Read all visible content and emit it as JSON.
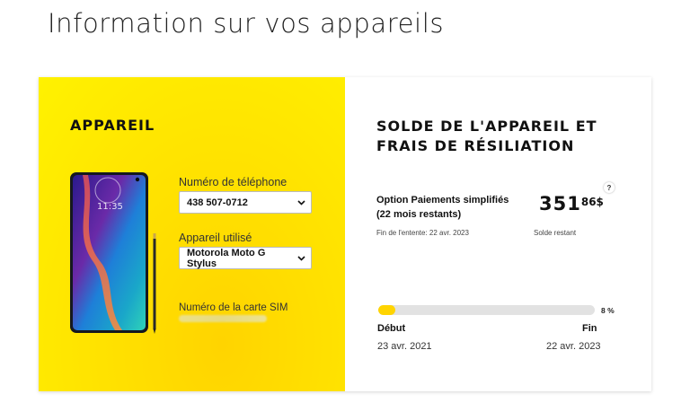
{
  "page": {
    "title": "Information sur vos appareils"
  },
  "device_panel": {
    "heading": "APPAREIL",
    "phone_number_label": "Numéro de téléphone",
    "phone_number_value": "438 507-0712",
    "device_label": "Appareil utilisé",
    "device_value": "Motorola Moto G Stylus",
    "sim_label": "Numéro de la carte SIM",
    "phone_clock": "11:35"
  },
  "balance_panel": {
    "heading": "SOLDE DE L'APPAREIL ET FRAIS DE RÉSILIATION",
    "option_title": "Option Paiements simplifiés (22 mois restants)",
    "agreement_end": "Fin de l'entente: 22 avr. 2023",
    "help": "?",
    "balance_integer": "351",
    "balance_decimal": "86",
    "balance_currency": "$",
    "balance_caption": "Solde restant",
    "progress_percent": 8,
    "progress_label": "8 %",
    "start_label": "Début",
    "end_label": "Fin",
    "start_date": "23 avr. 2021",
    "end_date": "22 avr. 2023"
  },
  "colors": {
    "brand_yellow": "#ffe000",
    "progress_fill": "#ffd400",
    "progress_track": "#e2e2e2"
  }
}
